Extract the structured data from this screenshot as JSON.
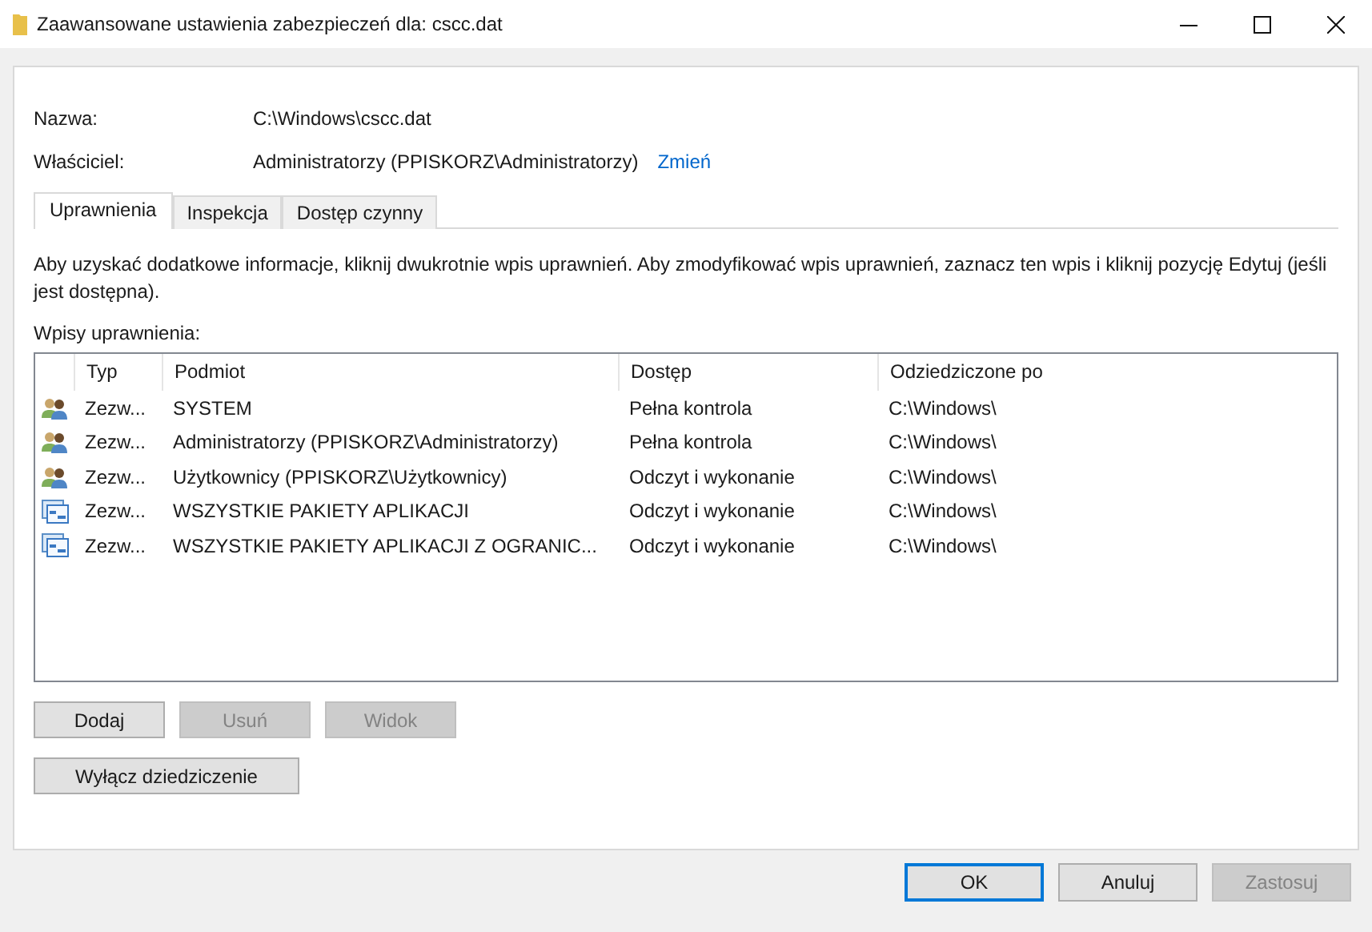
{
  "window": {
    "title": "Zaawansowane ustawienia zabezpieczeń dla: cscc.dat"
  },
  "name": {
    "label": "Nazwa:",
    "value": "C:\\Windows\\cscc.dat"
  },
  "owner": {
    "label": "Właściciel:",
    "value": "Administratorzy (PPISKORZ\\Administratorzy)",
    "link": "Zmień"
  },
  "tabs": [
    {
      "label": "Uprawnienia",
      "selected": true
    },
    {
      "label": "Inspekcja",
      "selected": false
    },
    {
      "label": "Dostęp czynny",
      "selected": false
    }
  ],
  "info": "Aby uzyskać dodatkowe informacje, kliknij dwukrotnie wpis uprawnień. Aby zmodyfikować wpis uprawnień, zaznacz ten wpis i kliknij pozycję Edytuj (jeśli jest dostępna).",
  "entries_label": "Wpisy uprawnienia:",
  "table": {
    "columns": [
      "Typ",
      "Podmiot",
      "Dostęp",
      "Odziedziczone po"
    ],
    "rows": [
      {
        "kind": "group",
        "type": "Zezw...",
        "principal": "SYSTEM",
        "access": "Pełna kontrola",
        "inherited": "C:\\Windows\\"
      },
      {
        "kind": "group",
        "type": "Zezw...",
        "principal": "Administratorzy (PPISKORZ\\Administratorzy)",
        "access": "Pełna kontrola",
        "inherited": "C:\\Windows\\"
      },
      {
        "kind": "group",
        "type": "Zezw...",
        "principal": "Użytkownicy (PPISKORZ\\Użytkownicy)",
        "access": "Odczyt i wykonanie",
        "inherited": "C:\\Windows\\"
      },
      {
        "kind": "package",
        "type": "Zezw...",
        "principal": "WSZYSTKIE PAKIETY APLIKACJI",
        "access": "Odczyt i wykonanie",
        "inherited": "C:\\Windows\\"
      },
      {
        "kind": "package",
        "type": "Zezw...",
        "principal": "WSZYSTKIE PAKIETY APLIKACJI Z OGRANIC...",
        "access": "Odczyt i wykonanie",
        "inherited": "C:\\Windows\\"
      }
    ]
  },
  "entry_buttons": [
    {
      "label": "Dodaj",
      "disabled": false
    },
    {
      "label": "Usuń",
      "disabled": true
    },
    {
      "label": "Widok",
      "disabled": true
    }
  ],
  "inheritance_button": {
    "label": "Wyłącz dziedziczenie"
  },
  "dialog_buttons": [
    {
      "label": "OK",
      "disabled": false,
      "default": true
    },
    {
      "label": "Anuluj",
      "disabled": false,
      "default": false
    },
    {
      "label": "Zastosuj",
      "disabled": true,
      "default": false
    }
  ]
}
